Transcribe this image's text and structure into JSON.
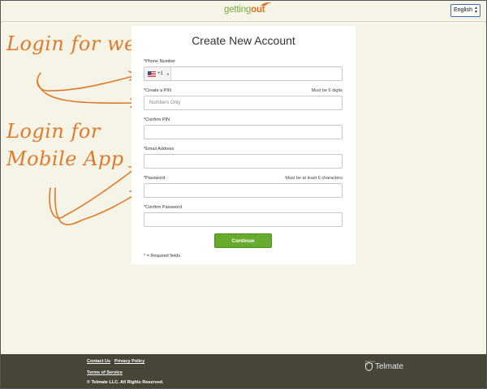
{
  "header": {
    "logo_part1": "getting",
    "logo_part2": "out",
    "language_selected": "English"
  },
  "form": {
    "title": "Create New Account",
    "fields": [
      {
        "label": "*Phone Number",
        "hint": "",
        "placeholder": "",
        "country_code": "+1"
      },
      {
        "label": "*Create a PIN",
        "hint": "Must be 6 digits",
        "placeholder": "Numbers Only"
      },
      {
        "label": "*Confirm PIN",
        "hint": "",
        "placeholder": ""
      },
      {
        "label": "*Email Address",
        "hint": "",
        "placeholder": ""
      },
      {
        "label": "*Password",
        "hint": "Must be at least 6 characters",
        "placeholder": ""
      },
      {
        "label": "*Confirm Password",
        "hint": "",
        "placeholder": ""
      }
    ],
    "continue_label": "Continue",
    "required_note": "* = Required fields"
  },
  "annotations": {
    "web": "Login for web",
    "mobile_line1": "Login for",
    "mobile_line2": "Mobile App"
  },
  "footer": {
    "contact_us": "Contact Us",
    "privacy_policy": "Privacy Policy",
    "terms": "Terms of Service",
    "copyright": "© Telmate LLC. All Rights Reserved.",
    "powered_by": "Powered by",
    "brand": "Telmate"
  },
  "colors": {
    "background": "#f6f3e7",
    "accent_green": "#66ab2b",
    "annotation_orange": "#e07a2a",
    "footer": "#474538"
  }
}
